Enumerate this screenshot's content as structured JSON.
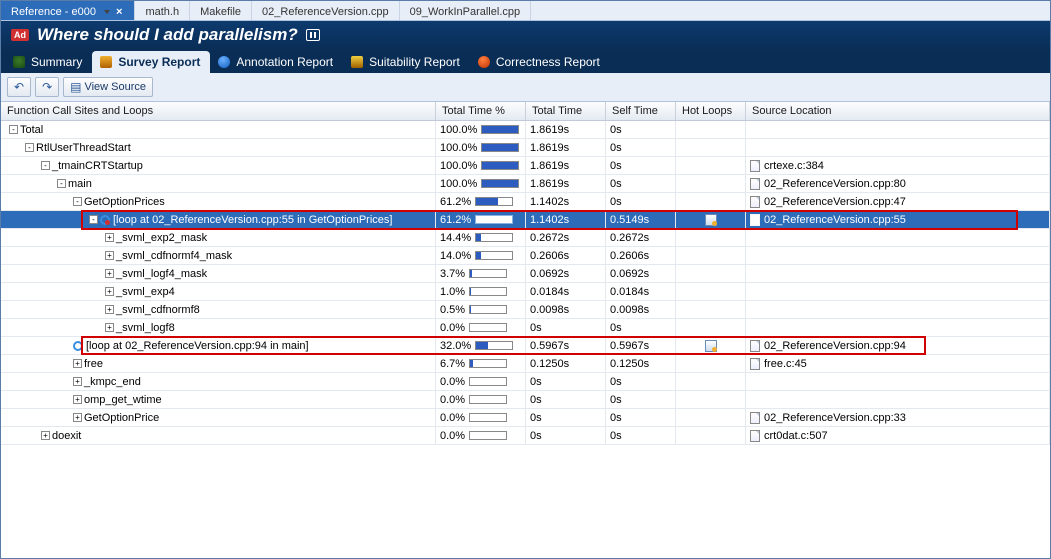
{
  "file_tabs": {
    "active_label": "Reference - e000",
    "others": [
      "math.h",
      "Makefile",
      "02_ReferenceVersion.cpp",
      "09_WorkInParallel.cpp"
    ]
  },
  "title": "Where should I add parallelism?",
  "report_tabs": {
    "summary": "Summary",
    "survey": "Survey Report",
    "annotation": "Annotation Report",
    "suitability": "Suitability Report",
    "correctness": "Correctness Report"
  },
  "toolbar": {
    "view_source": "View Source"
  },
  "columns": {
    "func": "Function Call Sites and Loops",
    "pct": "Total Time %",
    "total": "Total Time",
    "self": "Self Time",
    "hot": "Hot Loops",
    "src": "Source Location"
  },
  "rows": [
    {
      "indent": 0,
      "box": "-",
      "name": "Total",
      "pct": "100.0%",
      "bar": 100,
      "total": "1.8619s",
      "self": "0s",
      "hot": false,
      "src": ""
    },
    {
      "indent": 1,
      "box": "-",
      "name": "RtlUserThreadStart",
      "pct": "100.0%",
      "bar": 100,
      "total": "1.8619s",
      "self": "0s",
      "hot": false,
      "src": ""
    },
    {
      "indent": 2,
      "box": "-",
      "name": "_tmainCRTStartup",
      "pct": "100.0%",
      "bar": 100,
      "total": "1.8619s",
      "self": "0s",
      "hot": false,
      "src": "crtexe.c:384",
      "file": true
    },
    {
      "indent": 3,
      "box": "-",
      "name": "main",
      "pct": "100.0%",
      "bar": 100,
      "total": "1.8619s",
      "self": "0s",
      "hot": false,
      "src": "02_ReferenceVersion.cpp:80",
      "file": true
    },
    {
      "indent": 4,
      "box": "-",
      "name": "GetOptionPrices",
      "pct": "61.2%",
      "bar": 61,
      "total": "1.1402s",
      "self": "0s",
      "hot": false,
      "src": "02_ReferenceVersion.cpp:47",
      "file": true
    },
    {
      "indent": 5,
      "box": "-",
      "loop": "sub",
      "name": "[loop at 02_ReferenceVersion.cpp:55 in GetOptionPrices]",
      "pct": "61.2%",
      "bar": 61,
      "total": "1.1402s",
      "self": "0.5149s",
      "hot": true,
      "src": "02_ReferenceVersion.cpp:55",
      "file": true,
      "selected": true
    },
    {
      "indent": 6,
      "box": "+",
      "name": "_svml_exp2_mask",
      "pct": "14.4%",
      "bar": 14,
      "total": "0.2672s",
      "self": "0.2672s",
      "hot": false,
      "src": ""
    },
    {
      "indent": 6,
      "box": "+",
      "name": "_svml_cdfnormf4_mask",
      "pct": "14.0%",
      "bar": 14,
      "total": "0.2606s",
      "self": "0.2606s",
      "hot": false,
      "src": ""
    },
    {
      "indent": 6,
      "box": "+",
      "name": "_svml_logf4_mask",
      "pct": "3.7%",
      "bar": 4,
      "total": "0.0692s",
      "self": "0.0692s",
      "hot": false,
      "src": ""
    },
    {
      "indent": 6,
      "box": "+",
      "name": "_svml_exp4",
      "pct": "1.0%",
      "bar": 1,
      "total": "0.0184s",
      "self": "0.0184s",
      "hot": false,
      "src": ""
    },
    {
      "indent": 6,
      "box": "+",
      "name": "_svml_cdfnormf8",
      "pct": "0.5%",
      "bar": 1,
      "total": "0.0098s",
      "self": "0.0098s",
      "hot": false,
      "src": ""
    },
    {
      "indent": 6,
      "box": "+",
      "name": "_svml_logf8",
      "pct": "0.0%",
      "bar": 0,
      "total": "0s",
      "self": "0s",
      "hot": false,
      "src": ""
    },
    {
      "indent": 4,
      "box": "",
      "loop": "plain",
      "name": "[loop at 02_ReferenceVersion.cpp:94 in main]",
      "pct": "32.0%",
      "bar": 32,
      "total": "0.5967s",
      "self": "0.5967s",
      "hot": true,
      "src": "02_ReferenceVersion.cpp:94",
      "file": true
    },
    {
      "indent": 4,
      "box": "+",
      "name": "free",
      "pct": "6.7%",
      "bar": 7,
      "total": "0.1250s",
      "self": "0.1250s",
      "hot": false,
      "src": "free.c:45",
      "file": true
    },
    {
      "indent": 4,
      "box": "+",
      "name": "_kmpc_end",
      "pct": "0.0%",
      "bar": 0,
      "total": "0s",
      "self": "0s",
      "hot": false,
      "src": ""
    },
    {
      "indent": 4,
      "box": "+",
      "name": "omp_get_wtime",
      "pct": "0.0%",
      "bar": 0,
      "total": "0s",
      "self": "0s",
      "hot": false,
      "src": ""
    },
    {
      "indent": 4,
      "box": "+",
      "name": "GetOptionPrice",
      "pct": "0.0%",
      "bar": 0,
      "total": "0s",
      "self": "0s",
      "hot": false,
      "src": "02_ReferenceVersion.cpp:33",
      "file": true
    },
    {
      "indent": 2,
      "box": "+",
      "name": "doexit",
      "pct": "0.0%",
      "bar": 0,
      "total": "0s",
      "self": "0s",
      "hot": false,
      "src": "crt0dat.c:507",
      "file": true
    }
  ]
}
